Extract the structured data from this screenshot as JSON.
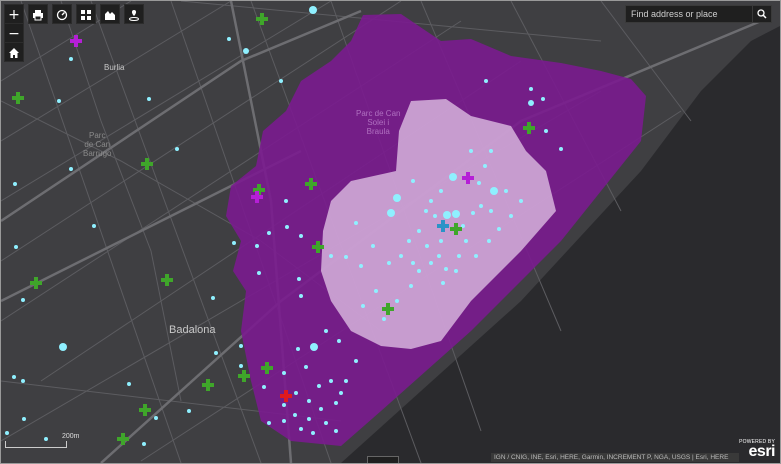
{
  "toolbar": {
    "zoom_in": "+",
    "zoom_out": "−",
    "home_icon": "home-icon",
    "print_icon": "print-icon",
    "measure_icon": "measure-icon",
    "basemap_icon": "basemap-gallery-icon",
    "layers_icon": "layers-icon",
    "locate_icon": "locate-icon"
  },
  "search": {
    "placeholder": "Find address or place",
    "icon": "search-icon"
  },
  "map_labels": {
    "burlia": "Burlia",
    "parc_sant_barrugo": "Parc\nde Can\nBarrugo",
    "parc_can_solei": "Parc de Can\nSolei i\nBraula",
    "badalona": "Badalona"
  },
  "attribution": "IGN / CNIG, INE, Esri, HERE, Garmin, INCREMENT P, NGA, USGS | Esri, HERE",
  "esri": {
    "powered": "POWERED BY",
    "word": "esri"
  },
  "scalebar": "200m",
  "colors": {
    "basemap": "#3f3f42",
    "sea": "#2a2a2d",
    "outer_zone": "#7a1b8f",
    "inner_zone": "#d6b3dc",
    "point": "#8ff0ff",
    "green_marker": "#3fa62a",
    "purple_marker": "#b51fd6",
    "red_marker": "#e0191e",
    "blue_marker": "#2a93c7"
  }
}
